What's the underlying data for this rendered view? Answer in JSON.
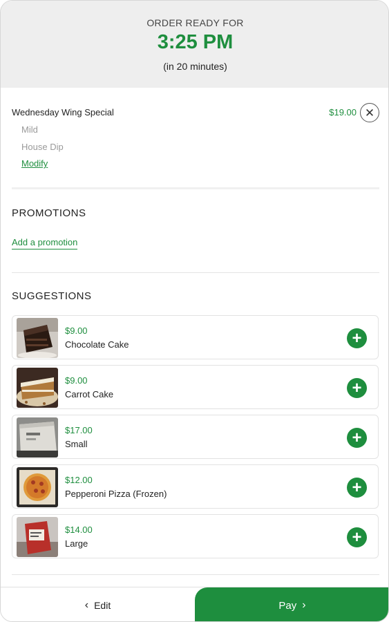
{
  "header": {
    "ready_label": "ORDER READY FOR",
    "ready_time": "3:25 PM",
    "ready_sub": "(in 20 minutes)"
  },
  "cart": {
    "item_name": "Wednesday Wing Special",
    "item_price": "$19.00",
    "modifiers": [
      "Mild",
      "House Dip"
    ],
    "modify_label": "Modify",
    "remove_icon": "close-icon"
  },
  "promotions": {
    "title": "PROMOTIONS",
    "add_label": "Add a promotion"
  },
  "suggestions": {
    "title": "SUGGESTIONS",
    "items": [
      {
        "price": "$9.00",
        "name": "Chocolate Cake"
      },
      {
        "price": "$9.00",
        "name": "Carrot Cake"
      },
      {
        "price": "$17.00",
        "name": "Small"
      },
      {
        "price": "$12.00",
        "name": "Pepperoni Pizza (Frozen)"
      },
      {
        "price": "$14.00",
        "name": "Large"
      }
    ]
  },
  "footer": {
    "edit_label": "Edit",
    "pay_label": "Pay"
  },
  "colors": {
    "accent": "#1e8e3e",
    "header_bg": "#eeeeee"
  }
}
